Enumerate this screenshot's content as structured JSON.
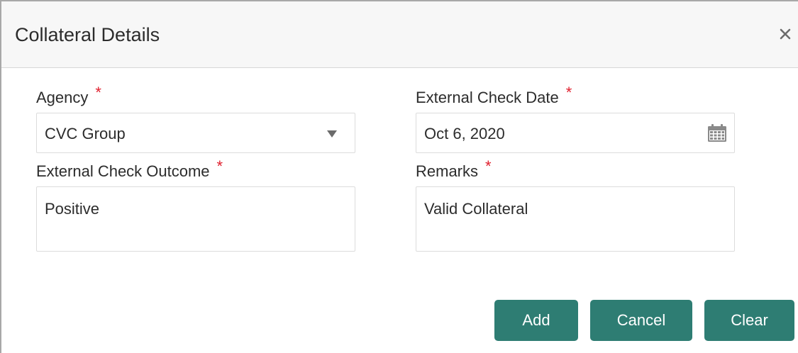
{
  "dialog": {
    "title": "Collateral Details",
    "close_icon": "close-icon"
  },
  "form": {
    "agency": {
      "label": "Agency",
      "required_marker": "*",
      "value": "CVC Group",
      "icon": "chevron-down-icon"
    },
    "external_check_date": {
      "label": "External Check Date",
      "required_marker": "*",
      "value": "Oct 6, 2020",
      "icon": "calendar-icon"
    },
    "external_check_outcome": {
      "label": "External Check Outcome",
      "required_marker": "*",
      "value": "Positive"
    },
    "remarks": {
      "label": "Remarks",
      "required_marker": "*",
      "value": "Valid Collateral"
    }
  },
  "buttons": {
    "add": "Add",
    "cancel": "Cancel",
    "clear": "Clear"
  },
  "colors": {
    "accent": "#2e7d73",
    "required": "#e0202e",
    "header_bg": "#f7f7f7"
  }
}
